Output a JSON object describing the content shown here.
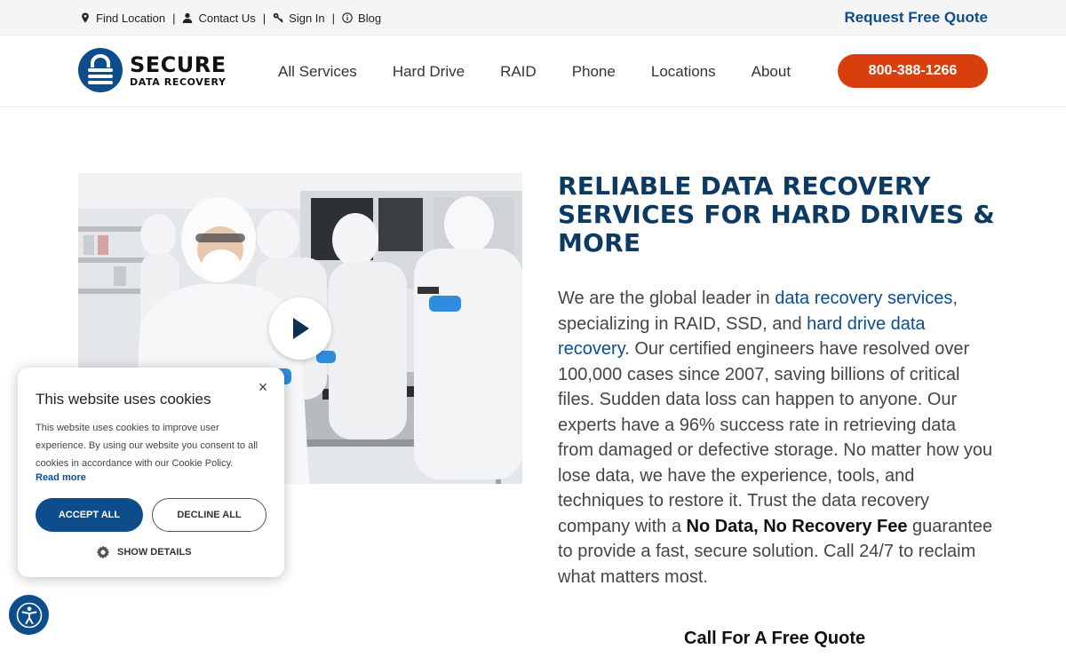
{
  "topbar": {
    "links": {
      "find_location": "Find Location",
      "contact_us": "Contact Us",
      "sign_in": "Sign In",
      "blog": "Blog"
    },
    "request_quote": "Request Free Quote"
  },
  "header": {
    "logo": {
      "top": "SECURE",
      "bottom": "DATA RECOVERY"
    },
    "nav": {
      "all_services": "All Services",
      "hard_drive": "Hard Drive",
      "raid": "RAID",
      "phone": "Phone",
      "locations": "Locations",
      "about": "About"
    },
    "phone": "800-388-1266"
  },
  "hero": {
    "title": "RELIABLE DATA RECOVERY SERVICES FOR HARD DRIVES & MORE",
    "body": {
      "p1": "We are the global leader in ",
      "link1": "data recovery services",
      "p2": ", specializing in RAID, SSD, and ",
      "link2": "hard drive data recovery",
      "p3": ". Our certified engineers have resolved over 100,000 cases since 2007, saving billions of critical files. Sudden data loss can happen to anyone. Our experts have a 96% success rate in retrieving data from damaged or defective storage. No matter how you lose data, we have the experience, tools, and techniques to restore it. Trust the data recovery company with a ",
      "bold": "No Data, No Recovery Fee",
      "p4": " guarantee to provide a fast, secure solution. Call 24/7 to reclaim what matters most."
    },
    "cta_heading": "Call For A Free Quote"
  },
  "cookie": {
    "title": "This website uses cookies",
    "text": "This website uses cookies to improve user experience. By using our website you consent to all cookies in accordance with our Cookie Policy.",
    "read_more": "Read more",
    "accept": "ACCEPT ALL",
    "decline": "DECLINE ALL",
    "show_details": "SHOW DETAILS",
    "close": "×"
  },
  "colors": {
    "brand_blue": "#0d4d8c",
    "heading_navy": "#0c3a63",
    "phone_orange": "#d93f0d"
  },
  "icons": {
    "find_location": "map-pin-icon",
    "contact_us": "user-icon",
    "sign_in": "key-icon",
    "blog": "info-icon",
    "video": "play-icon",
    "settings": "gear-icon",
    "accessibility": "accessibility-icon"
  }
}
